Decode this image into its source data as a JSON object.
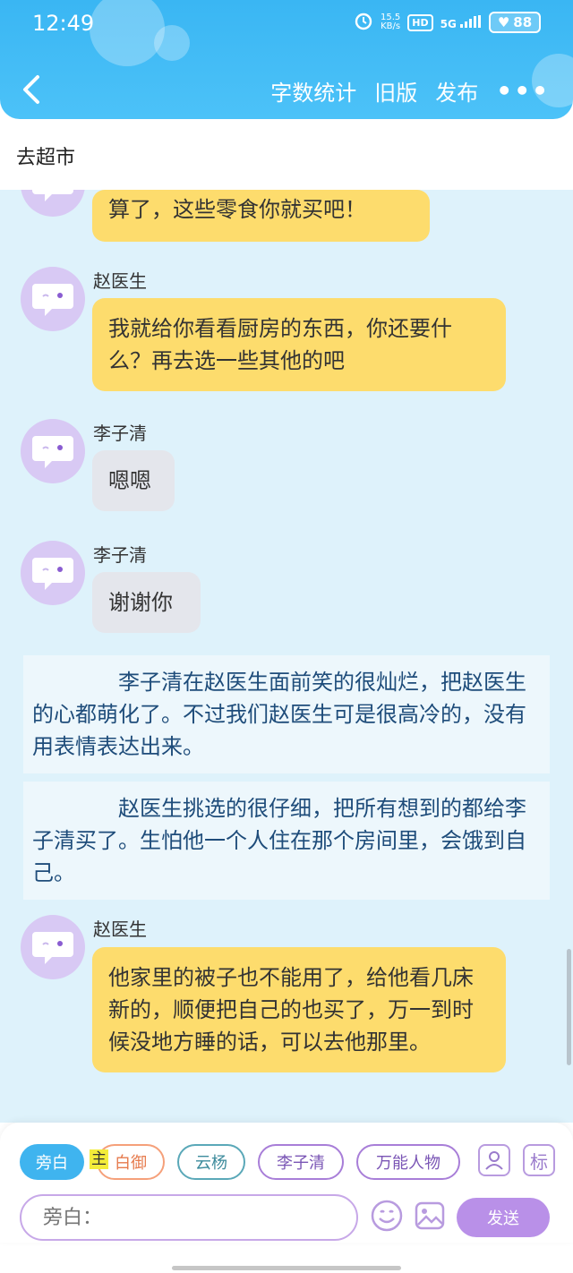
{
  "status_bar": {
    "time": "12:49",
    "net_speed_value": "15.5",
    "net_speed_unit": "KB/s",
    "hd": "HD",
    "signal": "5G",
    "battery": "88"
  },
  "header": {
    "actions": [
      "字数统计",
      "旧版",
      "发布"
    ],
    "more": "•••",
    "color": "#3ab6f3"
  },
  "doc": {
    "title": "去超市"
  },
  "chat": {
    "messages": [
      {
        "speaker": "",
        "text": "算了，这些零食你就买吧！",
        "style": "yellow"
      },
      {
        "speaker": "赵医生",
        "text": "我就给你看看厨房的东西，你还要什么？再去选一些其他的吧",
        "style": "yellow"
      },
      {
        "speaker": "李子清",
        "text": "嗯嗯",
        "style": "grey"
      },
      {
        "speaker": "李子清",
        "text": "谢谢你",
        "style": "grey"
      },
      {
        "speaker": "",
        "text": "李子清在赵医生面前笑的很灿烂，把赵医生的心都萌化了。不过我们赵医生可是很高冷的，没有用表情表达出来。",
        "style": "narration"
      },
      {
        "speaker": "",
        "text": "赵医生挑选的很仔细，把所有想到的都给李子清买了。生怕他一个人住在那个房间里，会饿到自己。",
        "style": "narration"
      },
      {
        "speaker": "赵医生",
        "text": "他家里的被子也不能用了，给他看几床新的，顺便把自己的也买了，万一到时候没地方睡的话，可以去他那里。",
        "style": "yellow"
      }
    ]
  },
  "composer": {
    "roles": [
      "旁白",
      "白御",
      "云杨",
      "李子清",
      "万能人物"
    ],
    "main_tag": "主",
    "tag_icon_label": "标",
    "input_placeholder": "旁白：",
    "send_label": "发送",
    "accent": "#b990e8"
  }
}
